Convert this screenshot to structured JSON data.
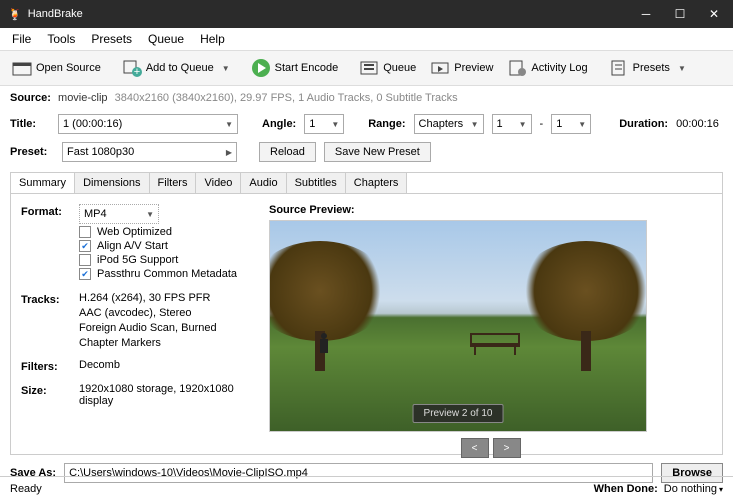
{
  "window": {
    "title": "HandBrake"
  },
  "menu": [
    "File",
    "Tools",
    "Presets",
    "Queue",
    "Help"
  ],
  "toolbar": {
    "open_source": "Open Source",
    "add_to_queue": "Add to Queue",
    "start_encode": "Start Encode",
    "queue": "Queue",
    "preview": "Preview",
    "activity_log": "Activity Log",
    "presets": "Presets"
  },
  "source": {
    "label": "Source:",
    "name": "movie-clip",
    "meta": "3840x2160 (3840x2160), 29.97 FPS, 1 Audio Tracks, 0 Subtitle Tracks"
  },
  "titleRow": {
    "title_label": "Title:",
    "title_value": "1   (00:00:16)",
    "angle_label": "Angle:",
    "angle_value": "1",
    "range_label": "Range:",
    "range_type": "Chapters",
    "range_from": "1",
    "range_sep": "-",
    "range_to": "1",
    "duration_label": "Duration:",
    "duration_value": "00:00:16"
  },
  "presetRow": {
    "label": "Preset:",
    "value": "Fast 1080p30",
    "reload": "Reload",
    "save_new": "Save New Preset"
  },
  "tabs": [
    "Summary",
    "Dimensions",
    "Filters",
    "Video",
    "Audio",
    "Subtitles",
    "Chapters"
  ],
  "activeTab": 0,
  "summary": {
    "format_label": "Format:",
    "format_value": "MP4",
    "checks": [
      {
        "label": "Web Optimized",
        "checked": false
      },
      {
        "label": "Align A/V Start",
        "checked": true
      },
      {
        "label": "iPod 5G Support",
        "checked": false
      },
      {
        "label": "Passthru Common Metadata",
        "checked": true
      }
    ],
    "tracks_label": "Tracks:",
    "tracks": [
      "H.264 (x264), 30 FPS PFR",
      "AAC (avcodec), Stereo",
      "Foreign Audio Scan, Burned",
      "Chapter Markers"
    ],
    "filters_label": "Filters:",
    "filters_value": "Decomb",
    "size_label": "Size:",
    "size_value": "1920x1080 storage, 1920x1080 display"
  },
  "preview": {
    "label": "Source Preview:",
    "overlay": "Preview 2 of 10",
    "prev": "<",
    "next": ">"
  },
  "saveAs": {
    "label": "Save As:",
    "path": "C:\\Users\\windows-10\\Videos\\Movie-ClipISO.mp4",
    "browse": "Browse"
  },
  "status": {
    "ready": "Ready",
    "when_done_label": "When Done:",
    "when_done_value": "Do nothing"
  }
}
